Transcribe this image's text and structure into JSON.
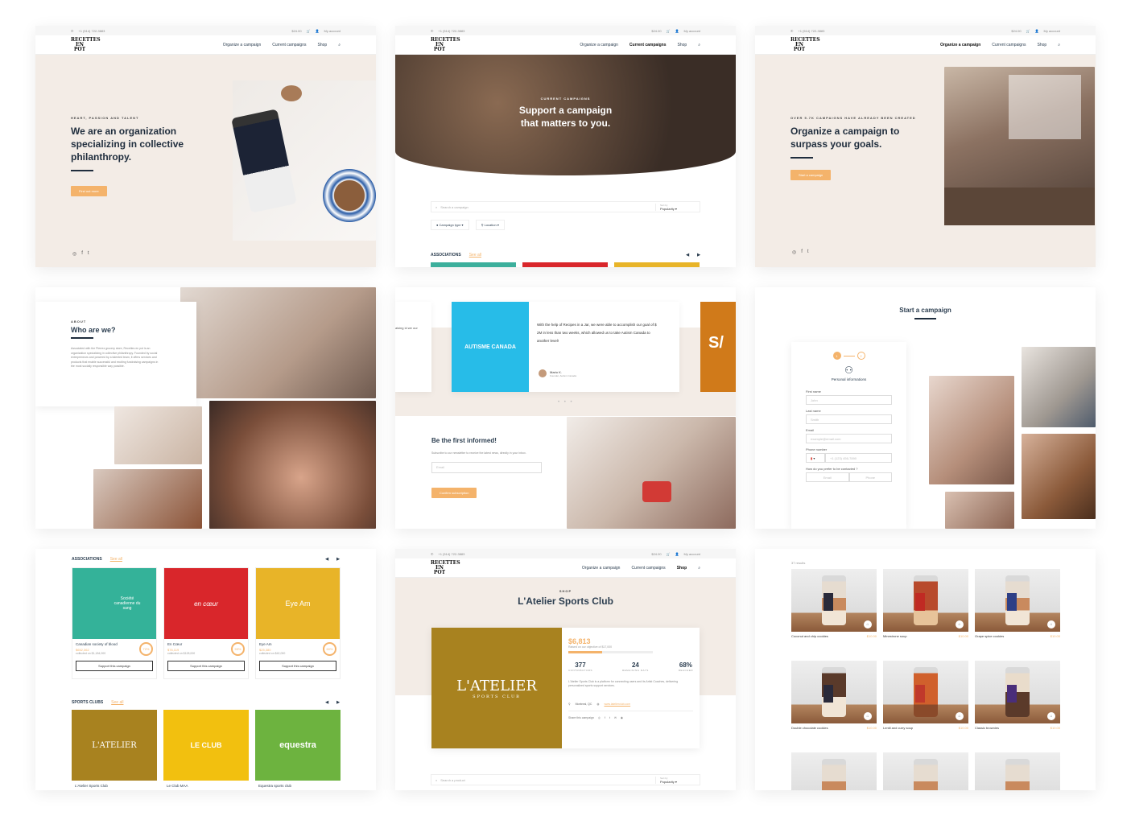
{
  "header": {
    "phone": "+1 (514) 722-3883",
    "cart": "$24.00",
    "account": "My account",
    "logo": "RECETTES EN POT",
    "nav": [
      "Organize a campaign",
      "Current campaigns",
      "Shop"
    ]
  },
  "panel1": {
    "eyebrow": "HEART, PASSION AND TALENT",
    "title": "We are an organization specializing in collective philanthropy.",
    "button": "Find out more",
    "social": [
      "◎",
      "f",
      "t"
    ]
  },
  "panel2": {
    "eyebrow": "CURRENT CAMPAIGNS",
    "title": "Support a campaign that matters to you.",
    "search_placeholder": "Search a campaign",
    "sort_label": "Sort by",
    "sort_value": "Popularity",
    "filter1": "Campaign type",
    "filter2": "Location",
    "section": "ASSOCIATIONS",
    "see_all": "See all"
  },
  "panel3": {
    "eyebrow": "OVER 5.7K CAMPAIGNS HAVE ALREADY BEEN CREATED",
    "title": "Organize a campaign to surpass your goals.",
    "button": "Start a campaign",
    "social": [
      "◎",
      "f",
      "t"
    ]
  },
  "panel4": {
    "eyebrow": "ABOUT",
    "title": "Who are we?",
    "body": "Associated with the Pierrez grocery store, Recettes en pot is an organization specializing in collective philanthropy. Founded by social entrepreneurs and powered by a talented team, it offers services and products that enable successful and exciting fundraising campaigns in the most socially responsible way possible."
  },
  "panel5": {
    "logo_text": "AUTISME CANADA",
    "quote": "With the help of Recipes in a Jar, we were able to accomplish our goal of $ 2M in less than two weeks, which allowed us to take Autism Canada to another level!",
    "author": "Mario K.",
    "author_role": "Founder, Autism Canada",
    "left_text": "aising id we our",
    "side_text": "S/",
    "news_title": "Be the first informed!",
    "news_body": "Subscribe to our newsletter to receive the latest news, directly in your inbox.",
    "email_placeholder": "Email",
    "button": "Confirm subscription"
  },
  "panel6": {
    "title": "Start a campaign",
    "step1": "1",
    "step2": "2",
    "section": "Personal informations",
    "fields": [
      {
        "label": "First name",
        "placeholder": "John"
      },
      {
        "label": "Last name",
        "placeholder": "Smith"
      },
      {
        "label": "Email",
        "placeholder": "example@email.com"
      },
      {
        "label": "Phone number",
        "placeholder": "+1 (123) 456-7890"
      }
    ],
    "contact_label": "How do you prefer to be contacted ?",
    "contact_options": [
      "Email",
      "Phone"
    ]
  },
  "panel7": {
    "section1": "ASSOCIATIONS",
    "section2": "SPORTS CLUBS",
    "see_all": "See all",
    "button": "Support this campaign",
    "cards": [
      {
        "name": "Canadian society of blood",
        "amount": "$652,362",
        "goal": "collected on $1,184,000",
        "pct": "72%",
        "logo": "Société canadienne du sang"
      },
      {
        "name": "En Cœur",
        "amount": "$76,119",
        "goal": "collected on $128,000",
        "pct": "59%",
        "logo": "en cœur"
      },
      {
        "name": "Eye Am",
        "amount": "$25,380",
        "goal": "collected on $42,000",
        "pct": "60%",
        "logo": "Eye Am"
      }
    ],
    "clubs": [
      {
        "name": "L'Atelier Sports Club",
        "logo": "L'ATELIER"
      },
      {
        "name": "Le Club MAA",
        "logo": "LE CLUB"
      },
      {
        "name": "Equestra sports club",
        "logo": "equestra"
      }
    ]
  },
  "panel8": {
    "eyebrow": "SHOP",
    "title": "L'Atelier Sports Club",
    "logo": "L'ATELIER",
    "logo_sub": "SPORTS CLUB",
    "amount": "$6,813",
    "goal": "Raised on our objective of $17,000",
    "progress": 0.4,
    "stats": [
      {
        "value": "377",
        "label": "CONTRIBUTORS"
      },
      {
        "value": "24",
        "label": "REMAINING DAYS"
      },
      {
        "value": "68%",
        "label": "REACHED"
      }
    ],
    "desc": "L'Atelier Sports Club is a platform for connecting users and its Artist Coaches, delivering personalized sports support services.",
    "location": "Montreal, QC",
    "website": "www.latelierclub.com",
    "share": "Share this campaign",
    "search_placeholder": "Search a product",
    "sort_label": "Sort by",
    "sort_value": "Popularity"
  },
  "panel9": {
    "results": "37 results",
    "products": [
      {
        "name": "Coconut and chip cookies",
        "price": "$10.00"
      },
      {
        "name": "Minestrone soup",
        "price": "$10.00"
      },
      {
        "name": "Grape spice cookies",
        "price": "$10.00"
      },
      {
        "name": "Double chocolate cookies",
        "price": "$10.00"
      },
      {
        "name": "Lentil and curry soup",
        "price": "$10.00"
      },
      {
        "name": "Classic brownies",
        "price": "$10.00"
      }
    ]
  }
}
